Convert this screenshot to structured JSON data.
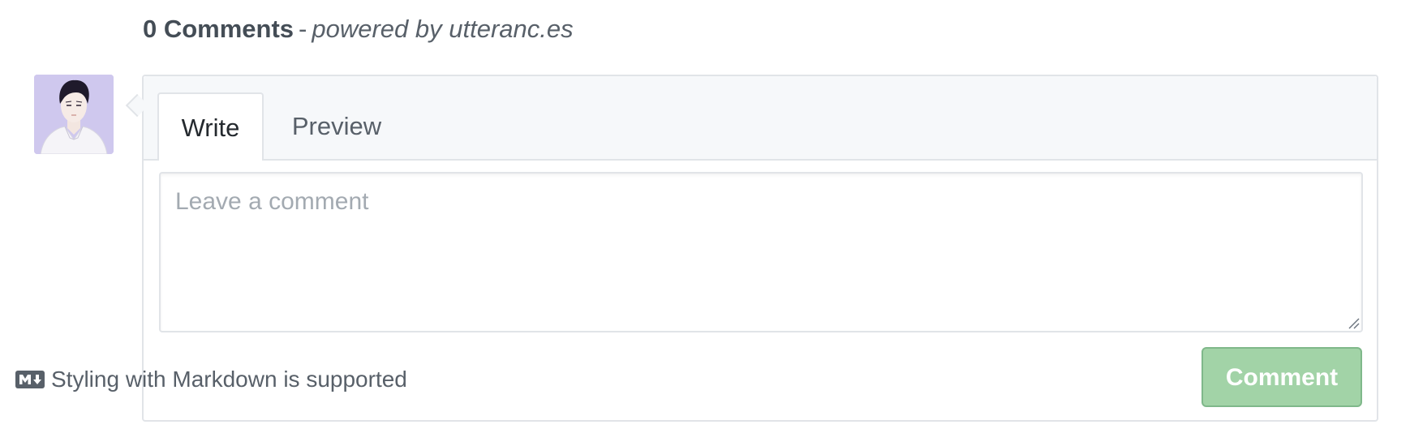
{
  "header": {
    "count_label": "0 Comments",
    "separator": "-",
    "powered_label": "powered by utteranc.es"
  },
  "avatar": {
    "icon": "user-avatar",
    "background": "#cfc8ee"
  },
  "tabs": [
    {
      "label": "Write",
      "active": true
    },
    {
      "label": "Preview",
      "active": false
    }
  ],
  "comment_input": {
    "value": "",
    "placeholder": "Leave a comment"
  },
  "footer": {
    "markdown_icon": "markdown-icon",
    "note": "Styling with Markdown is supported"
  },
  "submit": {
    "label": "Comment",
    "disabled": true,
    "color": "#a2d3a7"
  }
}
